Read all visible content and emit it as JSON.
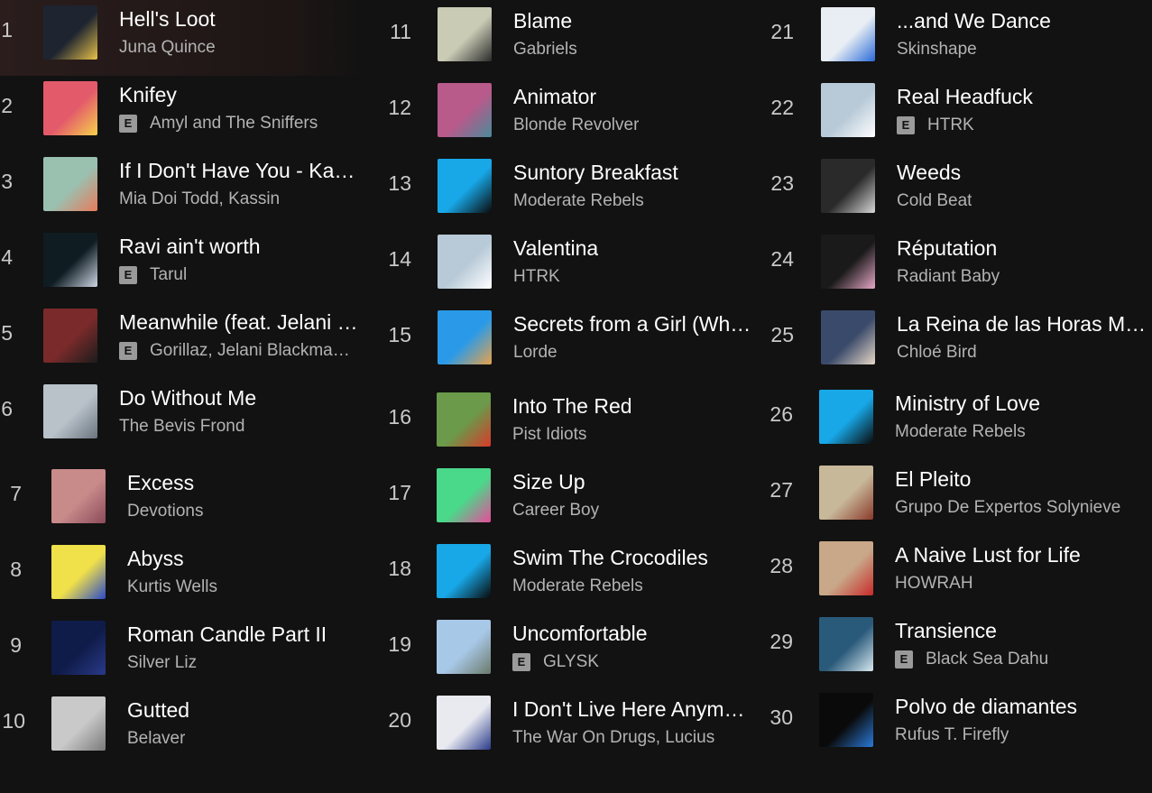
{
  "tracks": [
    {
      "n": "1",
      "title": "Hell's Loot",
      "artist": "Juna Quince",
      "explicit": false,
      "art": "#1e2430",
      "accent": "#e8c24a"
    },
    {
      "n": "2",
      "title": "Knifey",
      "artist": "Amyl and The Sniffers",
      "explicit": true,
      "art": "#e35a6a",
      "accent": "#f6d24b"
    },
    {
      "n": "3",
      "title": "If I Don't Have You - Kas…",
      "artist": "Mia Doi Todd, Kassin",
      "explicit": false,
      "art": "#9ac0b0",
      "accent": "#e87a5a"
    },
    {
      "n": "4",
      "title": "Ravi ain't worth",
      "artist": "Tarul",
      "explicit": true,
      "art": "#0f1c22",
      "accent": "#cfd7e6"
    },
    {
      "n": "5",
      "title": "Meanwhile (feat. Jelani …",
      "artist": "Gorillaz, Jelani Blackma…",
      "explicit": true,
      "art": "#7a2a2a",
      "accent": "#1c1c1c"
    },
    {
      "n": "6",
      "title": "Do Without Me",
      "artist": "The Bevis Frond",
      "explicit": false,
      "art": "#b9c2c9",
      "accent": "#6a7480"
    },
    {
      "n": "7",
      "title": "Excess",
      "artist": "Devotions",
      "explicit": false,
      "art": "#c98a8a",
      "accent": "#8a4a5a"
    },
    {
      "n": "8",
      "title": "Abyss",
      "artist": "Kurtis Wells",
      "explicit": false,
      "art": "#f0e04a",
      "accent": "#2a4ac8"
    },
    {
      "n": "9",
      "title": "Roman Candle Part II",
      "artist": "Silver Liz",
      "explicit": false,
      "art": "#0f1c4a",
      "accent": "#2a3a8a"
    },
    {
      "n": "10",
      "title": "Gutted",
      "artist": "Belaver",
      "explicit": false,
      "art": "#c9c9c9",
      "accent": "#7a7a7a"
    },
    {
      "n": "11",
      "title": "Blame",
      "artist": "Gabriels",
      "explicit": false,
      "art": "#c9cbb5",
      "accent": "#2a2a2a"
    },
    {
      "n": "12",
      "title": "Animator",
      "artist": "Blonde Revolver",
      "explicit": false,
      "art": "#b85a8a",
      "accent": "#4a8a9a"
    },
    {
      "n": "13",
      "title": "Suntory Breakfast",
      "artist": "Moderate Rebels",
      "explicit": false,
      "art": "#18a8e8",
      "accent": "#0a0a0a"
    },
    {
      "n": "14",
      "title": "Valentina",
      "artist": "HTRK",
      "explicit": false,
      "art": "#b8cad8",
      "accent": "#ffffff"
    },
    {
      "n": "15",
      "title": "Secrets from a Girl (Wh…",
      "artist": "Lorde",
      "explicit": false,
      "art": "#2a9ae8",
      "accent": "#e8a24a"
    },
    {
      "n": "16",
      "title": "Into The Red",
      "artist": "Pist Idiots",
      "explicit": false,
      "art": "#6a9a4a",
      "accent": "#d83a2a"
    },
    {
      "n": "17",
      "title": "Size Up",
      "artist": "Career Boy",
      "explicit": false,
      "art": "#4ad88a",
      "accent": "#e84a9a"
    },
    {
      "n": "18",
      "title": "Swim The Crocodiles",
      "artist": "Moderate Rebels",
      "explicit": false,
      "art": "#18a8e8",
      "accent": "#0a0a0a"
    },
    {
      "n": "19",
      "title": "Uncomfortable",
      "artist": "GLYSK",
      "explicit": true,
      "art": "#a8c8e8",
      "accent": "#6a7a6a"
    },
    {
      "n": "20",
      "title": "I Don't Live Here Anym…",
      "artist": "The War On Drugs, Lucius",
      "explicit": false,
      "art": "#e8eaf0",
      "accent": "#2a3a8a"
    },
    {
      "n": "21",
      "title": "...and We Dance",
      "artist": "Skinshape",
      "explicit": false,
      "art": "#e8eef4",
      "accent": "#2a6ad8"
    },
    {
      "n": "22",
      "title": "Real Headfuck",
      "artist": "HTRK",
      "explicit": true,
      "art": "#b8cad8",
      "accent": "#ffffff"
    },
    {
      "n": "23",
      "title": "Weeds",
      "artist": "Cold Beat",
      "explicit": false,
      "art": "#2a2a2a",
      "accent": "#d8d8d8"
    },
    {
      "n": "24",
      "title": "Réputation",
      "artist": "Radiant Baby",
      "explicit": false,
      "art": "#1a1a1a",
      "accent": "#e8a8c8"
    },
    {
      "n": "25",
      "title": "La Reina de las Horas M…",
      "artist": "Chloé Bird",
      "explicit": false,
      "art": "#3a4a6a",
      "accent": "#e8d8c8"
    },
    {
      "n": "26",
      "title": "Ministry of Love",
      "artist": "Moderate Rebels",
      "explicit": false,
      "art": "#18a8e8",
      "accent": "#0a0a0a"
    },
    {
      "n": "27",
      "title": "El Pleito",
      "artist": "Grupo De Expertos Solynieve",
      "explicit": false,
      "art": "#c8b89a",
      "accent": "#8a3a2a"
    },
    {
      "n": "28",
      "title": "A Naive Lust for Life",
      "artist": "HOWRAH",
      "explicit": false,
      "art": "#c8a888",
      "accent": "#c82a2a"
    },
    {
      "n": "29",
      "title": "Transience",
      "artist": "Black Sea Dahu",
      "explicit": true,
      "art": "#2a5a7a",
      "accent": "#d8e8f0"
    },
    {
      "n": "30",
      "title": "Polvo de diamantes",
      "artist": "Rufus T. Firefly",
      "explicit": false,
      "art": "#0a0a0a",
      "accent": "#2a7ad8"
    }
  ],
  "explicit_label": "E"
}
